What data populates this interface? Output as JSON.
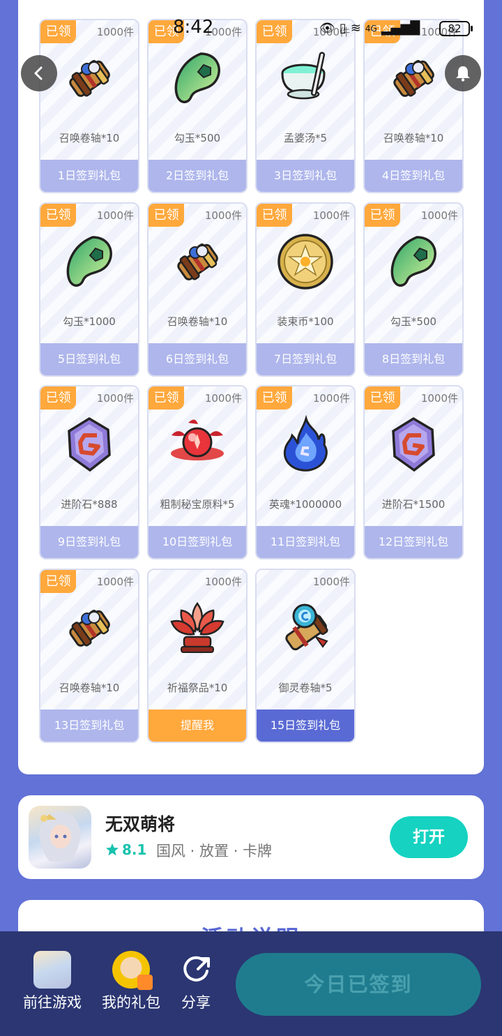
{
  "status_bar": {
    "time": "8:42",
    "battery": "82",
    "network": "4G"
  },
  "checkin_grid": {
    "tiles": [
      {
        "claimed": "已领",
        "qty": "1000件",
        "item": "召唤卷轴*10",
        "footer": "1日签到礼包",
        "icon": "summon-scroll-icon",
        "state": "claimed"
      },
      {
        "claimed": "已领",
        "qty": "1000件",
        "item": "勾玉*500",
        "footer": "2日签到礼包",
        "icon": "magatama-icon",
        "state": "claimed"
      },
      {
        "claimed": "已领",
        "qty": "1000件",
        "item": "孟婆汤*5",
        "footer": "3日签到礼包",
        "icon": "soup-bowl-icon",
        "state": "claimed"
      },
      {
        "claimed": "已领",
        "qty": "1000件",
        "item": "召唤卷轴*10",
        "footer": "4日签到礼包",
        "icon": "summon-scroll-icon",
        "state": "claimed"
      },
      {
        "claimed": "已领",
        "qty": "1000件",
        "item": "勾玉*1000",
        "footer": "5日签到礼包",
        "icon": "magatama-icon",
        "state": "claimed"
      },
      {
        "claimed": "已领",
        "qty": "1000件",
        "item": "召唤卷轴*10",
        "footer": "6日签到礼包",
        "icon": "summon-scroll-icon",
        "state": "claimed"
      },
      {
        "claimed": "已领",
        "qty": "1000件",
        "item": "装束币*100",
        "footer": "7日签到礼包",
        "icon": "gold-coin-icon",
        "state": "claimed"
      },
      {
        "claimed": "已领",
        "qty": "1000件",
        "item": "勾玉*500",
        "footer": "8日签到礼包",
        "icon": "magatama-icon",
        "state": "claimed"
      },
      {
        "claimed": "已领",
        "qty": "1000件",
        "item": "进阶石*888",
        "footer": "9日签到礼包",
        "icon": "advance-stone-icon",
        "state": "claimed"
      },
      {
        "claimed": "已领",
        "qty": "1000件",
        "item": "粗制秘宝原料*5",
        "footer": "10日签到礼包",
        "icon": "red-orb-icon",
        "state": "claimed"
      },
      {
        "claimed": "已领",
        "qty": "1000件",
        "item": "英魂*1000000",
        "footer": "11日签到礼包",
        "icon": "blue-spirit-flame-icon",
        "state": "claimed"
      },
      {
        "claimed": "已领",
        "qty": "1000件",
        "item": "进阶石*1500",
        "footer": "12日签到礼包",
        "icon": "advance-stone-icon",
        "state": "claimed"
      },
      {
        "claimed": "已领",
        "qty": "1000件",
        "item": "召唤卷轴*10",
        "footer": "13日签到礼包",
        "icon": "summon-scroll-icon",
        "state": "claimed"
      },
      {
        "claimed": "",
        "qty": "1000件",
        "item": "祈福祭品*10",
        "footer": "提醒我",
        "icon": "lotus-offering-icon",
        "state": "remind"
      },
      {
        "claimed": "",
        "qty": "1000件",
        "item": "御灵卷轴*5",
        "footer": "15日签到礼包",
        "icon": "spirit-scroll-icon",
        "state": "upcoming"
      }
    ]
  },
  "app_card": {
    "name": "无双萌将",
    "rating": "8.1",
    "tags": "国风 · 放置 · 卡牌",
    "open_label": "打开"
  },
  "rules_card": {
    "title": "∧ 活动说明 ∧"
  },
  "bottom_bar": {
    "goto_game": "前往游戏",
    "my_gifts": "我的礼包",
    "share": "分享",
    "signed_today": "今日已签到"
  },
  "colors": {
    "background": "#6272d6",
    "claimed_badge": "#ffa83c",
    "footer_claimed": "#aeb6ec",
    "footer_next": "#5a6ad4",
    "open_button": "#15d2c1",
    "bottom_bar": "#2b3672"
  }
}
